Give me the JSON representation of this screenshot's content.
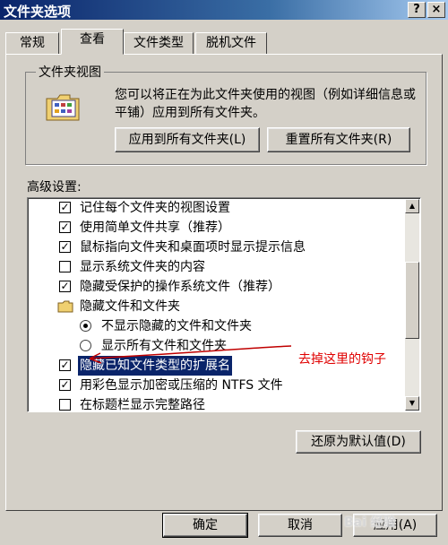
{
  "window": {
    "title": "文件夹选项",
    "help_glyph": "?",
    "close_glyph": "×"
  },
  "tabs": [
    {
      "label": "常规"
    },
    {
      "label": "查看"
    },
    {
      "label": "文件类型"
    },
    {
      "label": "脱机文件"
    }
  ],
  "active_tab": "查看",
  "folder_views": {
    "legend": "文件夹视图",
    "description": "您可以将正在为此文件夹使用的视图（例如详细信息或平铺）应用到所有文件夹。",
    "apply_all_label": "应用到所有文件夹(L)",
    "reset_all_label": "重置所有文件夹(R)"
  },
  "advanced": {
    "label": "高级设置:",
    "items": [
      {
        "type": "checkbox",
        "checked": true,
        "label": "记住每个文件夹的视图设置"
      },
      {
        "type": "checkbox",
        "checked": true,
        "label": "使用简单文件共享（推荐）"
      },
      {
        "type": "checkbox",
        "checked": true,
        "label": "鼠标指向文件夹和桌面项时显示提示信息"
      },
      {
        "type": "checkbox",
        "checked": false,
        "label": "显示系统文件夹的内容"
      },
      {
        "type": "checkbox",
        "checked": true,
        "label": "隐藏受保护的操作系统文件（推荐）"
      },
      {
        "type": "folder",
        "label": "隐藏文件和文件夹"
      },
      {
        "type": "radio",
        "checked": true,
        "label": "不显示隐藏的文件和文件夹"
      },
      {
        "type": "radio",
        "checked": false,
        "label": "显示所有文件和文件夹"
      },
      {
        "type": "checkbox",
        "checked": true,
        "label": "隐藏已知文件类型的扩展名",
        "selected": true
      },
      {
        "type": "checkbox",
        "checked": true,
        "label": "用彩色显示加密或压缩的 NTFS 文件"
      },
      {
        "type": "checkbox",
        "checked": false,
        "label": "在标题栏显示完整路径"
      }
    ],
    "restore_defaults_label": "还原为默认值(D)"
  },
  "annotation": {
    "text": "去掉这里的钩子",
    "color": "#e00000"
  },
  "footer": {
    "ok_label": "确定",
    "cancel_label": "取消",
    "apply_label": "应用(A)"
  },
  "watermark": "Bai 经验",
  "colors": {
    "selection": "#0a246a",
    "dialog_bg": "#d4d0c8",
    "title_gradient_start": "#0a246a"
  }
}
